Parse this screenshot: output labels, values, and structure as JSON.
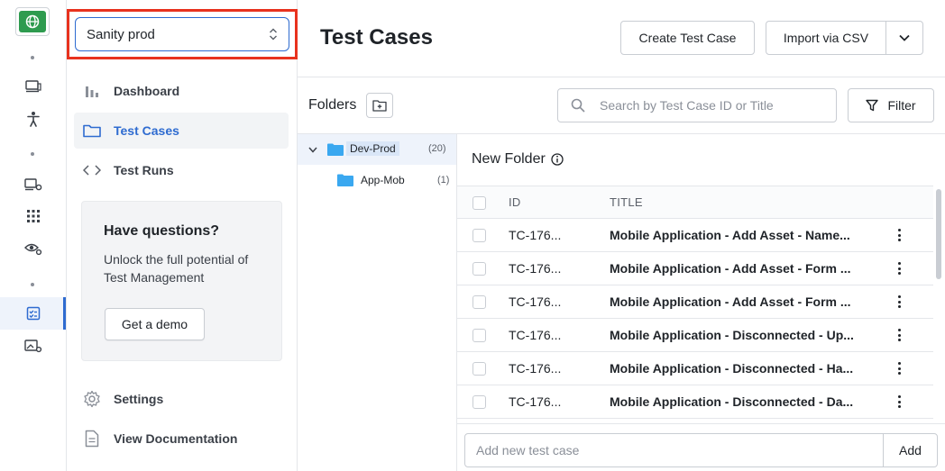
{
  "project_selector": {
    "value": "Sanity prod"
  },
  "nav": {
    "items": [
      {
        "label": "Dashboard",
        "icon": "bar-chart-icon",
        "active": false
      },
      {
        "label": "Test Cases",
        "icon": "folder-icon",
        "active": true
      },
      {
        "label": "Test Runs",
        "icon": "code-icon",
        "active": false
      }
    ],
    "footer_items": [
      {
        "label": "Settings",
        "icon": "gear-icon"
      },
      {
        "label": "View Documentation",
        "icon": "document-icon"
      }
    ]
  },
  "promo": {
    "title": "Have questions?",
    "text": "Unlock the full potential of Test Management",
    "button": "Get a demo"
  },
  "header": {
    "title": "Test Cases",
    "create_button": "Create Test Case",
    "import_button": "Import via CSV"
  },
  "folders": {
    "label": "Folders",
    "tree": [
      {
        "name": "Dev-Prod",
        "count": "(20)",
        "selected": true,
        "expanded": true
      },
      {
        "name": "App-Mob",
        "count": "(1)",
        "selected": false
      }
    ]
  },
  "search": {
    "placeholder": "Search by Test Case ID or Title"
  },
  "filter": {
    "label": "Filter"
  },
  "table": {
    "folder_title": "New Folder",
    "columns": {
      "id": "ID",
      "title": "TITLE"
    },
    "rows": [
      {
        "id": "TC-176...",
        "title": "Mobile Application - Add Asset - Name..."
      },
      {
        "id": "TC-176...",
        "title": "Mobile Application - Add Asset - Form ..."
      },
      {
        "id": "TC-176...",
        "title": "Mobile Application - Add Asset - Form ..."
      },
      {
        "id": "TC-176...",
        "title": "Mobile Application - Disconnected - Up..."
      },
      {
        "id": "TC-176...",
        "title": "Mobile Application - Disconnected - Ha..."
      },
      {
        "id": "TC-176...",
        "title": "Mobile Application - Disconnected - Da..."
      }
    ]
  },
  "add_case": {
    "placeholder": "Add new test case",
    "button": "Add"
  },
  "colors": {
    "accent": "#2e6bd0",
    "highlight_border": "#e8321e",
    "brand": "#2e9b4f",
    "folder": "#3aa8f0"
  }
}
